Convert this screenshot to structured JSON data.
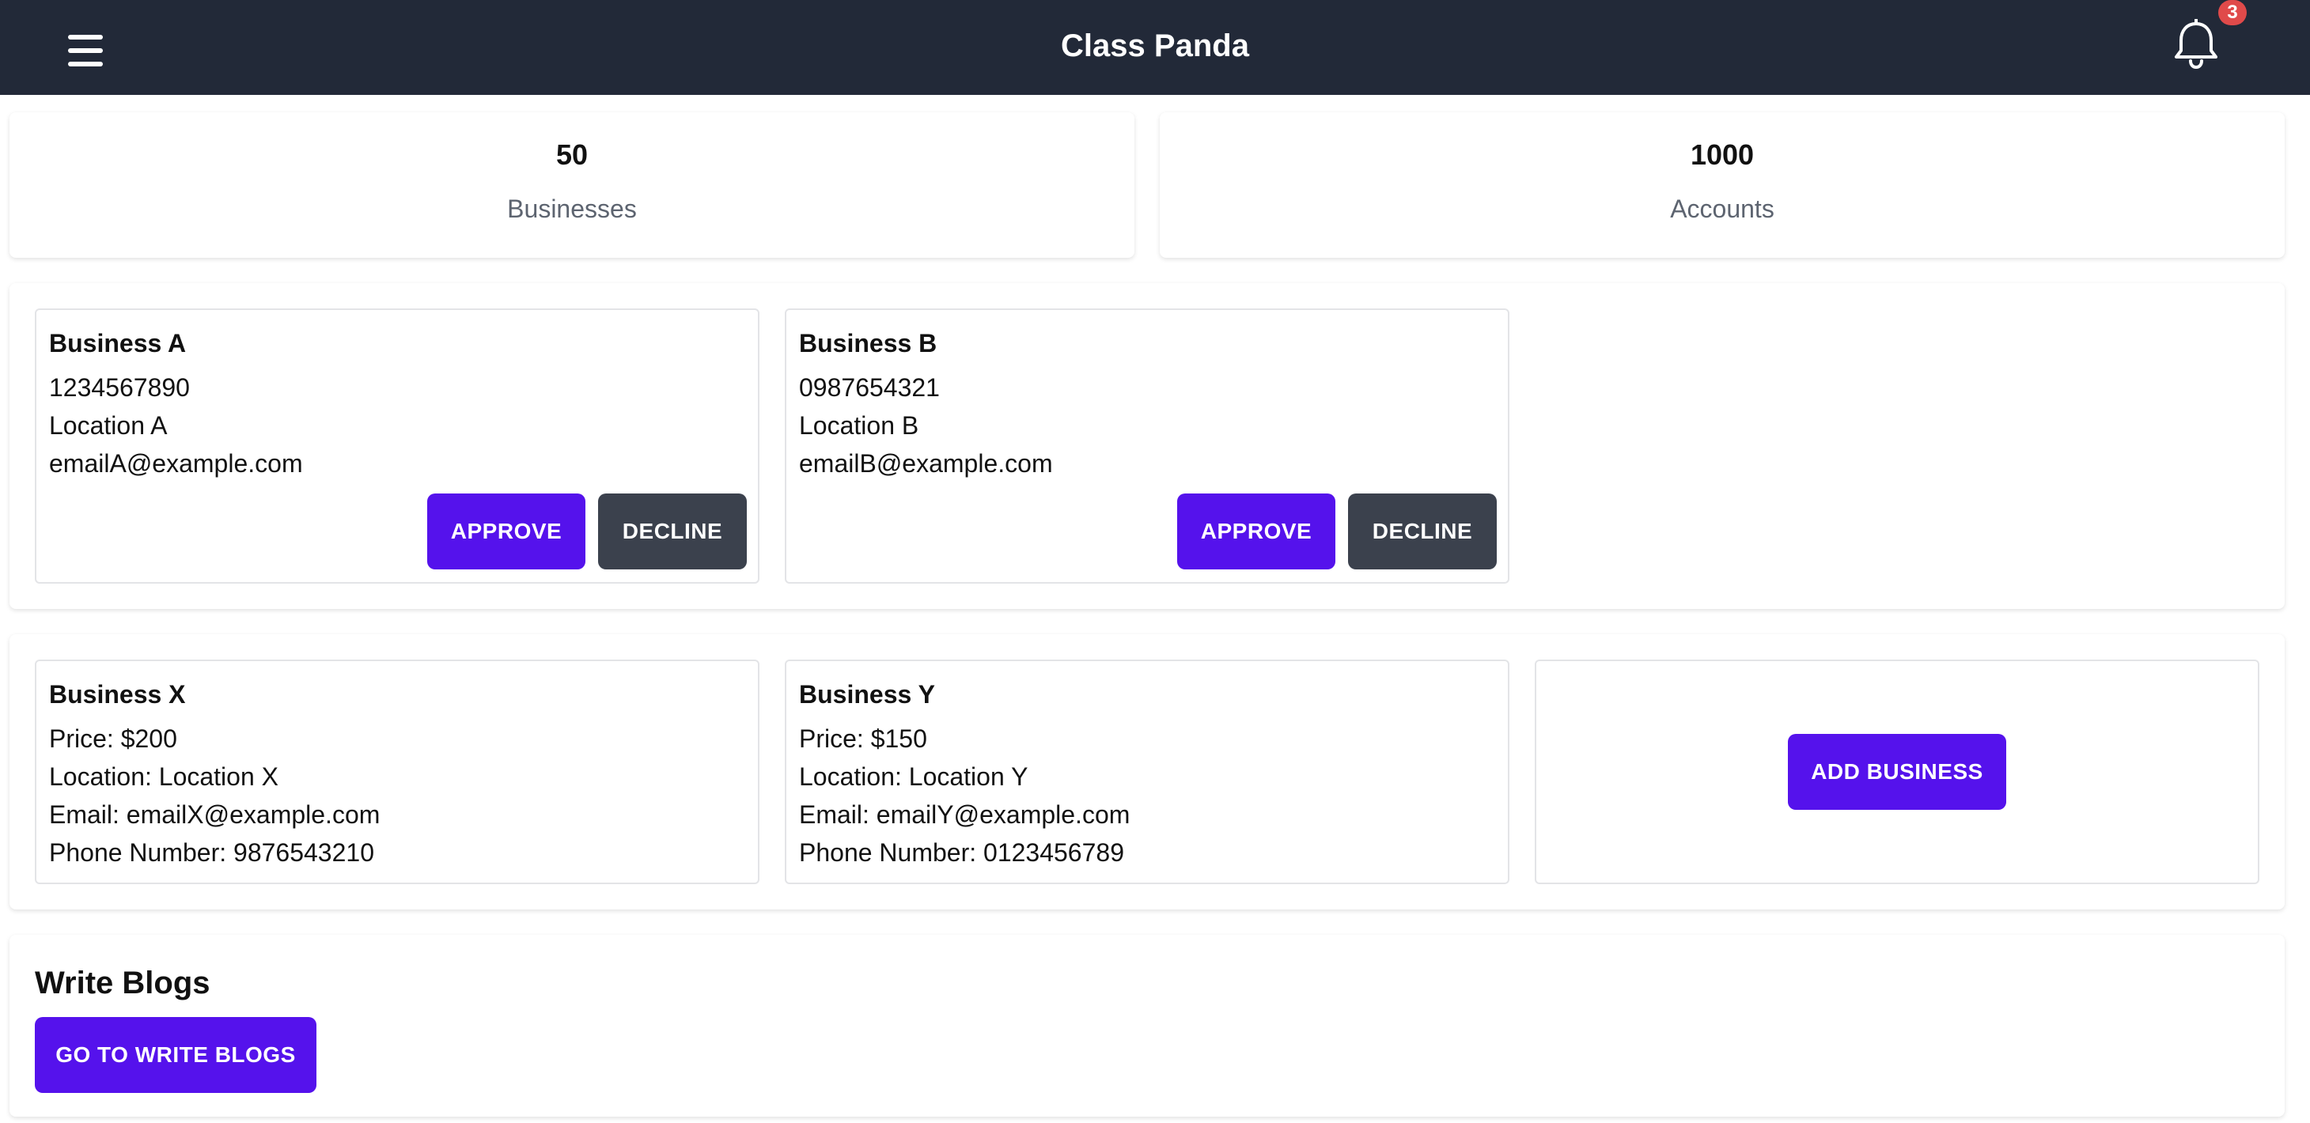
{
  "header": {
    "title": "Class Panda",
    "menu_icon": "hamburger-menu-icon",
    "notifications_icon": "bell-icon",
    "notification_count": "3",
    "background": "#222938"
  },
  "stats": [
    {
      "value": "50",
      "label": "Businesses"
    },
    {
      "value": "1000",
      "label": "Accounts"
    }
  ],
  "pending_businesses": [
    {
      "name": "Business A",
      "phone": "1234567890",
      "location": "Location A",
      "email": "emailA@example.com",
      "approve_label": "APPROVE",
      "decline_label": "DECLINE"
    },
    {
      "name": "Business B",
      "phone": "0987654321",
      "location": "Location B",
      "email": "emailB@example.com",
      "approve_label": "APPROVE",
      "decline_label": "DECLINE"
    }
  ],
  "listed_businesses": [
    {
      "name": "Business X",
      "price": "Price: $200",
      "location": "Location: Location X",
      "email": "Email: emailX@example.com",
      "phone": "Phone Number: 9876543210"
    },
    {
      "name": "Business Y",
      "price": "Price: $150",
      "location": "Location: Location Y",
      "email": "Email: emailY@example.com",
      "phone": "Phone Number: 0123456789"
    }
  ],
  "add_business_label": "ADD BUSINESS",
  "blogs": {
    "heading": "Write Blogs",
    "button_label": "GO TO WRITE BLOGS"
  },
  "colors": {
    "primary": "#5512ec",
    "secondary_button": "#3b414d",
    "badge": "#e04a4a"
  }
}
